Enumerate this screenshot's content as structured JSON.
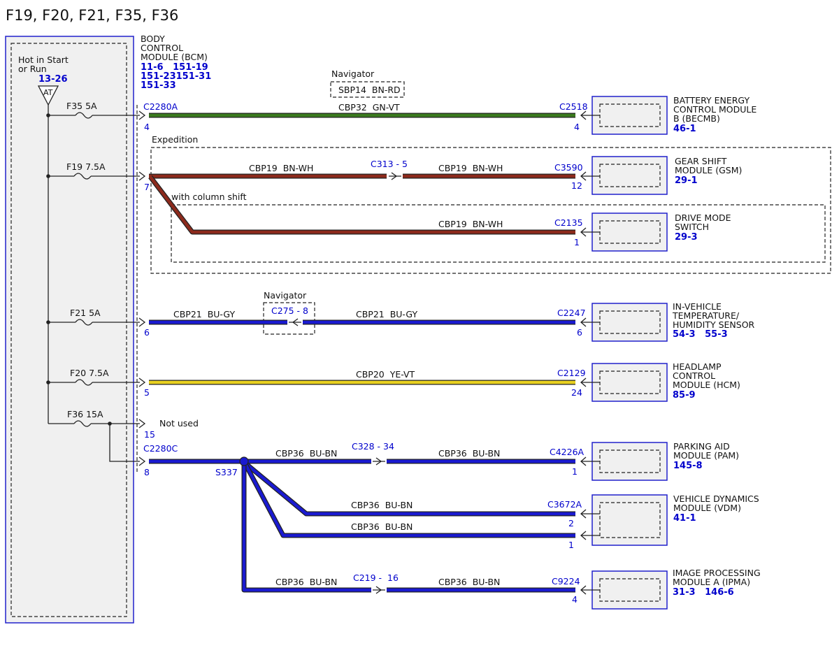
{
  "title": "F19, F20, F21, F35, F36",
  "bcm": {
    "name_lines": [
      "BODY",
      "CONTROL",
      "MODULE (BCM)"
    ],
    "refs": [
      "11-6   151-19",
      "151-23151-31",
      "151-33"
    ],
    "hot_lines": [
      "Hot in Start",
      "or Run"
    ],
    "hot_ref": "13-26",
    "at_label": "AT"
  },
  "fuses": [
    {
      "label": "F35  5A"
    },
    {
      "label": "F19  7.5A"
    },
    {
      "label": "F21  5A"
    },
    {
      "label": "F20  7.5A"
    },
    {
      "label": "F36  15A"
    }
  ],
  "connectors": {
    "c2280a": "C2280A",
    "c2280c": "C2280C",
    "pin4": "4",
    "pin7": "7",
    "pin6": "6",
    "pin5": "5",
    "pin15": "15",
    "pin8": "8",
    "not_used": "Not used",
    "splice": "S337"
  },
  "options": {
    "navigator_1": "Navigator",
    "sbp14": "SBP14  BN-RD",
    "expedition": "Expedition",
    "column_shift": "with column shift",
    "navigator_2": "Navigator"
  },
  "circuits": {
    "cbp32": "CBP32  GN-VT",
    "cbp19_a": "CBP19  BN-WH",
    "cbp19_b": "CBP19  BN-WH",
    "cbp19_c": "CBP19  BN-WH",
    "cbp21_a": "CBP21  BU-GY",
    "cbp21_b": "CBP21  BU-GY",
    "cbp20": "CBP20  YE-VT",
    "cbp36_a": "CBP36  BU-BN",
    "cbp36_b": "CBP36  BU-BN",
    "cbp36_c": "CBP36  BU-BN",
    "cbp36_d": "CBP36  BU-BN",
    "cbp36_e": "CBP36  BU-BN",
    "cbp36_f": "CBP36  BU-BN"
  },
  "inline": {
    "c313": "C313 - 5",
    "c275": "C275 - 8",
    "c328": "C328 - 34",
    "c219": "C219 -  16"
  },
  "modules": [
    {
      "conn": "C2518",
      "pin": "4",
      "name_lines": [
        "BATTERY ENERGY",
        "CONTROL MODULE",
        "B (BECMB)"
      ],
      "ref": "46-1"
    },
    {
      "conn": "C3590",
      "pin": "12",
      "name_lines": [
        "GEAR SHIFT",
        "MODULE (GSM)"
      ],
      "ref": "29-1"
    },
    {
      "conn": "C2135",
      "pin": "1",
      "name_lines": [
        "DRIVE MODE",
        "SWITCH"
      ],
      "ref": "29-3"
    },
    {
      "conn": "C2247",
      "pin": "6",
      "name_lines": [
        "IN-VEHICLE",
        "TEMPERATURE/",
        "HUMIDITY SENSOR"
      ],
      "ref": "54-3   55-3"
    },
    {
      "conn": "C2129",
      "pin": "24",
      "name_lines": [
        "HEADLAMP",
        "CONTROL",
        "MODULE (HCM)"
      ],
      "ref": "85-9"
    },
    {
      "conn": "C4226A",
      "pin": "1",
      "name_lines": [
        "PARKING AID",
        "MODULE (PAM)"
      ],
      "ref": "145-8"
    },
    {
      "conn": "C3672A",
      "pin": "2",
      "pin2": "1",
      "name_lines": [
        "VEHICLE DYNAMICS",
        "MODULE (VDM)"
      ],
      "ref": "41-1"
    },
    {
      "conn": "C9224",
      "pin": "4",
      "name_lines": [
        "IMAGE PROCESSING",
        "MODULE A (IPMA)"
      ],
      "ref": "31-3   146-6"
    }
  ],
  "colors": {
    "module_border": "#2020cc",
    "label_blue": "#0000cc",
    "wire_green": "#3a7a1e",
    "wire_brown": "#8c2a1c",
    "wire_blue": "#1a1ad0",
    "wire_yellow": "#e8d020",
    "wire_outline": "#222222"
  }
}
